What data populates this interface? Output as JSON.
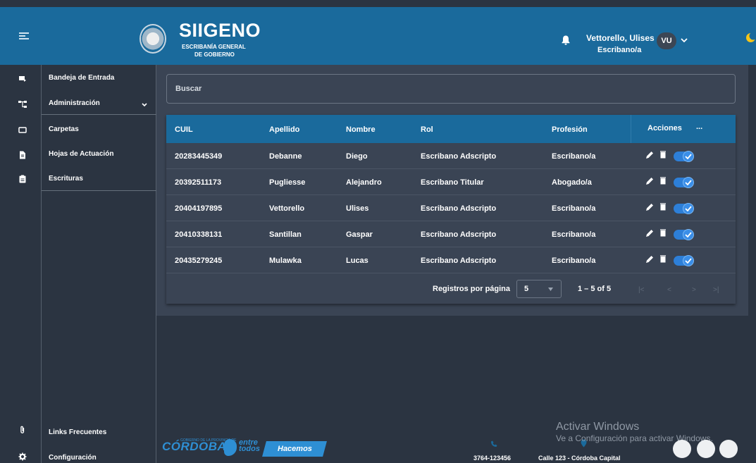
{
  "header": {
    "app_title": "SIIGENO",
    "subtitle_line1": "ESCRIBANÍA GENERAL",
    "subtitle_line2": "DE GOBIERNO",
    "user_name": "Vettorello, Ulises",
    "user_role": "Escribano/a",
    "avatar_initials": "VU"
  },
  "sidebar": {
    "items": [
      {
        "label": "Bandeja de Entrada",
        "icon": "inbox-icon"
      },
      {
        "label": "Administración",
        "icon": "sitemap-icon"
      },
      {
        "label": "Carpetas",
        "icon": "folder-icon"
      },
      {
        "label": "Hojas de Actuación",
        "icon": "file-icon"
      },
      {
        "label": "Escrituras",
        "icon": "clipboard-icon"
      }
    ],
    "bottom_items": [
      {
        "label": "Links Frecuentes",
        "icon": "paperclip-icon"
      },
      {
        "label": "Configuración",
        "icon": "gear-icon"
      }
    ]
  },
  "search": {
    "placeholder": "Buscar"
  },
  "table": {
    "columns": [
      "CUIL",
      "Apellido",
      "Nombre",
      "Rol",
      "Profesión",
      "Acciones"
    ],
    "actions_menu": "...",
    "rows": [
      {
        "cuil": "20283445349",
        "apellido": "Debanne",
        "nombre": "Diego",
        "rol": "Escribano Adscripto",
        "profesion": "Escribano/a",
        "active": true
      },
      {
        "cuil": "20392511173",
        "apellido": "Pugliesse",
        "nombre": "Alejandro",
        "rol": "Escribano Titular",
        "profesion": "Abogado/a",
        "active": true
      },
      {
        "cuil": "20404197895",
        "apellido": "Vettorello",
        "nombre": "Ulises",
        "rol": "Escribano Adscripto",
        "profesion": "Escribano/a",
        "active": true
      },
      {
        "cuil": "20410338131",
        "apellido": "Santillan",
        "nombre": "Gaspar",
        "rol": "Escribano Adscripto",
        "profesion": "Escribano/a",
        "active": true
      },
      {
        "cuil": "20435279245",
        "apellido": "Mulawka",
        "nombre": "Lucas",
        "rol": "Escribano Adscripto",
        "profesion": "Escribano/a",
        "active": true
      }
    ]
  },
  "pagination": {
    "label": "Registros por página",
    "page_size": "5",
    "range": "1 – 5 of 5",
    "first": "|<",
    "prev": "<",
    "next": ">",
    "last": ">|"
  },
  "footer": {
    "logo_cordoba": "CÓRDOBA",
    "logo_gob": "GOBIERNO DE LA PROVINCIA DE",
    "logo_entre": "entre",
    "logo_todos": "todos",
    "logo_hacemos": "Hacemos",
    "phone": "3764-123456",
    "address": "Calle 123 - Córdoba Capital"
  },
  "watermark": {
    "line1": "Activar Windows",
    "line2": "Ve a Configuración para activar Windows."
  },
  "colors": {
    "header": "#1a6a9c",
    "accent": "#2e8fd4",
    "background": "#2b3441",
    "card": "#3a4454"
  }
}
